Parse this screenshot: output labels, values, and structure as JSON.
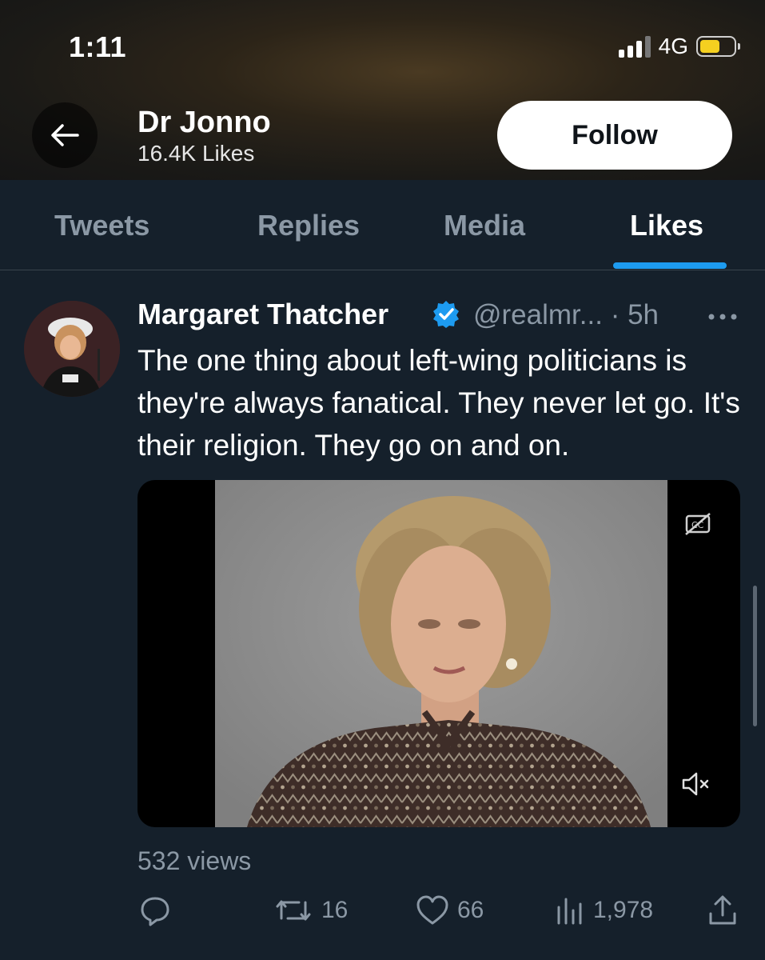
{
  "status_bar": {
    "time": "1:11",
    "network": "4G"
  },
  "profile": {
    "name": "Dr Jonno",
    "likes_count": "16.4K Likes",
    "follow_label": "Follow"
  },
  "tabs": [
    {
      "label": "Tweets",
      "active": false
    },
    {
      "label": "Replies",
      "active": false
    },
    {
      "label": "Media",
      "active": false
    },
    {
      "label": "Likes",
      "active": true
    }
  ],
  "tweet": {
    "author": "Margaret Thatcher",
    "handle": "@realmr...",
    "separator": "·",
    "time": "5h",
    "text": "The one thing about left-wing politicians is they're always fanatical. They never let go. It's their religion. They go on and on.",
    "views": "532 views",
    "retweets": "16",
    "likes": "66",
    "view_count": "1,978"
  },
  "colors": {
    "accent": "#1d9bf0",
    "background": "#15202b",
    "muted": "#8b98a5"
  },
  "icons": [
    "back-arrow-icon",
    "verified-badge-icon",
    "more-icon",
    "captions-off-icon",
    "muted-speaker-icon",
    "reply-icon",
    "retweet-icon",
    "like-icon",
    "views-icon",
    "share-icon"
  ]
}
